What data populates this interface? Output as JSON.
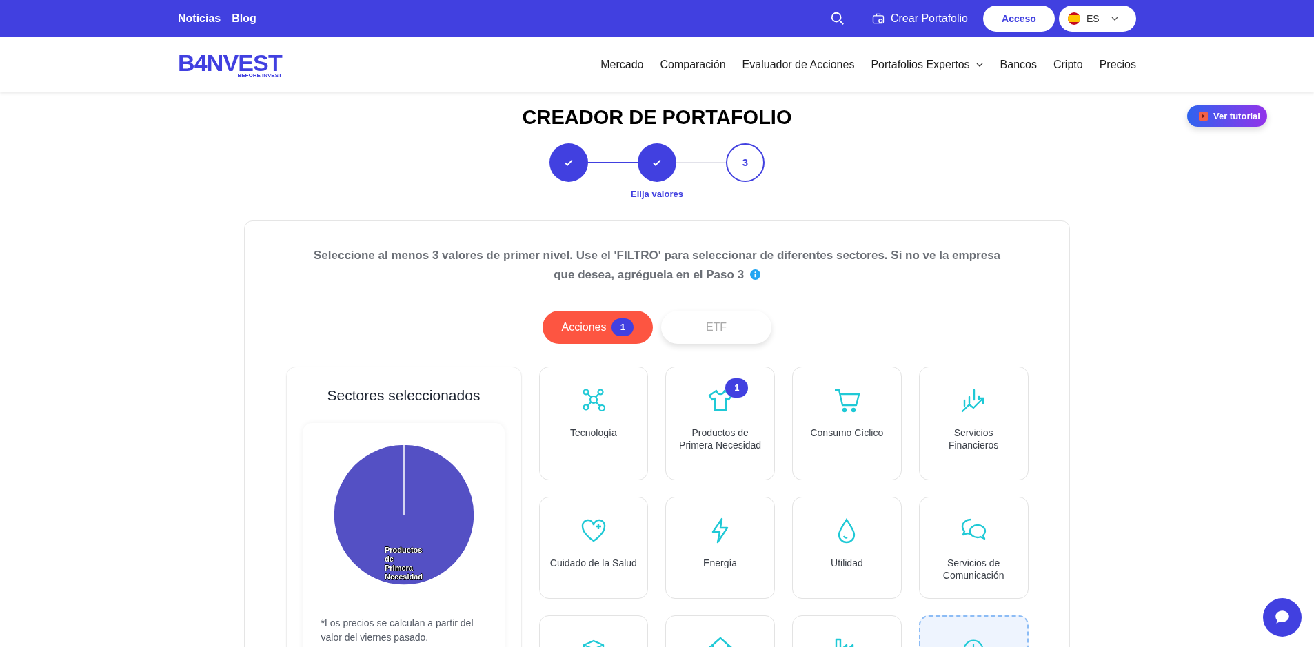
{
  "top_bar": {
    "links": [
      "Noticias",
      "Blog"
    ],
    "create_label": "Crear Portafolio",
    "login_label": "Acceso",
    "language": "ES"
  },
  "logo": {
    "text": "B4NVEST",
    "tagline": "BEFORE INVEST"
  },
  "nav": [
    {
      "label": "Mercado",
      "has_menu": false
    },
    {
      "label": "Comparación",
      "has_menu": false
    },
    {
      "label": "Evaluador de Acciones",
      "has_menu": false
    },
    {
      "label": "Portafolios Expertos",
      "has_menu": true
    },
    {
      "label": "Bancos",
      "has_menu": false
    },
    {
      "label": "Cripto",
      "has_menu": false
    },
    {
      "label": "Precios",
      "has_menu": false
    }
  ],
  "title": "CREADOR DE PORTAFOLIO",
  "tutorial_label": "Ver tutorial",
  "steps": [
    {
      "completed": true
    },
    {
      "completed": true,
      "caption": "Elija valores"
    },
    {
      "completed": false,
      "number": "3"
    }
  ],
  "instructions": "Seleccione al menos 3 valores de primer nivel. Use el 'FILTRO' para seleccionar de diferentes sectores. Si no ve la empresa que desea, agréguela en el Paso 3",
  "tabs": [
    {
      "label": "Acciones",
      "selected": true,
      "badge": "1"
    },
    {
      "label": "ETF",
      "selected": false
    }
  ],
  "selected_sectors": {
    "title": "Sectores seleccionados",
    "chart_data": {
      "type": "pie",
      "categories": [
        "Productos de Primera Necesidad"
      ],
      "values": [
        100
      ]
    },
    "footnote": "*Los precios se calculan a partir del valor del viernes pasado."
  },
  "sectors": [
    {
      "kind": "sector",
      "label": "Tecnología"
    },
    {
      "kind": "sector",
      "label": "Productos de Primera Necesidad",
      "badge": "1"
    },
    {
      "kind": "sector",
      "label": "Consumo Cíclico"
    },
    {
      "kind": "sector",
      "label": "Servicios Financieros"
    },
    {
      "kind": "sector",
      "label": "Cuidado de la Salud"
    },
    {
      "kind": "sector",
      "label": "Energía"
    },
    {
      "kind": "sector",
      "label": "Utilidad"
    },
    {
      "kind": "sector",
      "label": "Servicios de Comunicación"
    },
    {
      "kind": "sector"
    },
    {
      "kind": "sector"
    },
    {
      "kind": "sector"
    },
    {
      "kind": "add"
    }
  ]
}
